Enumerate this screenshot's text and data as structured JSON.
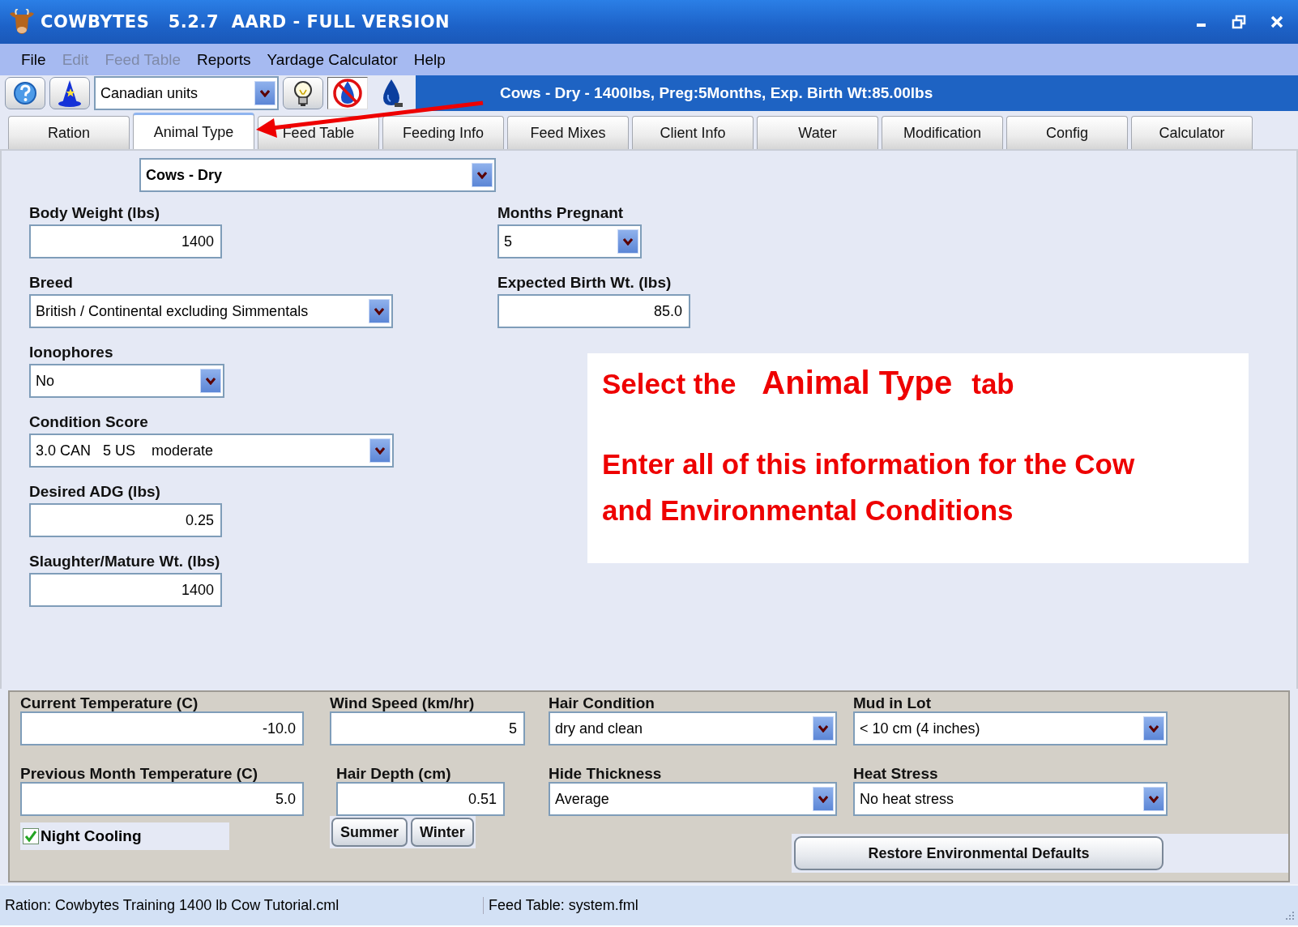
{
  "window": {
    "title": "COWBYTES   5.2.7  AARD - FULL VERSION"
  },
  "menu": [
    {
      "label": "File",
      "disabled": false
    },
    {
      "label": "Edit",
      "disabled": true
    },
    {
      "label": "Feed Table",
      "disabled": true
    },
    {
      "label": "Reports",
      "disabled": false
    },
    {
      "label": "Yardage Calculator",
      "disabled": false
    },
    {
      "label": "Help",
      "disabled": false
    }
  ],
  "toolbar": {
    "buttons": [
      {
        "kind": "help",
        "pressed": false
      },
      {
        "kind": "wizard",
        "pressed": false
      },
      {
        "kind": "units",
        "value": "Canadian units"
      },
      {
        "kind": "bulb",
        "pressed": false
      },
      {
        "kind": "no-water",
        "pressed": true
      },
      {
        "kind": "water",
        "pressed": false
      }
    ],
    "summary": "Cows - Dry - 1400lbs, Preg:5Months, Exp. Birth Wt:85.00lbs"
  },
  "tabs": [
    {
      "label": "Ration",
      "selected": false
    },
    {
      "label": "Animal Type",
      "selected": true
    },
    {
      "label": "Feed Table",
      "selected": false
    },
    {
      "label": "Feeding Info",
      "selected": false
    },
    {
      "label": "Feed Mixes",
      "selected": false
    },
    {
      "label": "Client Info",
      "selected": false
    },
    {
      "label": "Water",
      "selected": false
    },
    {
      "label": "Modification",
      "selected": false
    },
    {
      "label": "Config",
      "selected": false
    },
    {
      "label": "Calculator",
      "selected": false
    }
  ],
  "animal_type": {
    "value": "Cows - Dry"
  },
  "left_fields": [
    {
      "label": "Body Weight (lbs)",
      "kind": "input",
      "value": "1400"
    },
    {
      "label": "Breed",
      "kind": "dropdown",
      "value": "British / Continental excluding Simmentals"
    },
    {
      "label": "Ionophores",
      "kind": "dropdown",
      "value": "No"
    },
    {
      "label": "Condition Score",
      "kind": "dropdown",
      "value": "3.0 CAN   5 US    moderate"
    },
    {
      "label": "Desired ADG (lbs)",
      "kind": "input",
      "value": "0.25"
    },
    {
      "label": "Slaughter/Mature Wt. (lbs)",
      "kind": "input",
      "value": "1400"
    }
  ],
  "right_fields": [
    {
      "label": "Months Pregnant",
      "kind": "dropdown",
      "value": "5"
    },
    {
      "label": "Expected Birth Wt. (lbs)",
      "kind": "input",
      "value": "85.0"
    }
  ],
  "callout": {
    "heading": [
      "Select the",
      "Animal Type",
      "tab"
    ],
    "body": "Enter all of this information for the Cow and Environmental Conditions"
  },
  "environment": {
    "fields": [
      {
        "label": "Current Temperature (C)",
        "kind": "input",
        "value": "-10.0"
      },
      {
        "label": "Wind Speed (km/hr)",
        "kind": "input",
        "value": "5"
      },
      {
        "label": "Hair Condition",
        "kind": "dropdown",
        "value": "dry and clean"
      },
      {
        "label": "Mud in Lot",
        "kind": "dropdown",
        "value": "< 10 cm (4 inches)"
      },
      {
        "label": "Previous Month Temperature (C)",
        "kind": "input",
        "value": "5.0"
      },
      {
        "label": "Hair Depth (cm)",
        "kind": "input",
        "value": "0.51"
      },
      {
        "label": "Hide Thickness",
        "kind": "dropdown",
        "value": "Average"
      },
      {
        "label": "Heat Stress",
        "kind": "dropdown",
        "value": "No heat stress"
      }
    ],
    "night_cooling": {
      "label": "Night Cooling",
      "checked": true
    },
    "season_buttons": [
      "Summer",
      "Winter"
    ],
    "restore_button": "Restore Environmental Defaults"
  },
  "status_bar": [
    "Ration: Cowbytes Training 1400 lb Cow Tutorial.cml",
    "Feed Table: system.fml"
  ]
}
